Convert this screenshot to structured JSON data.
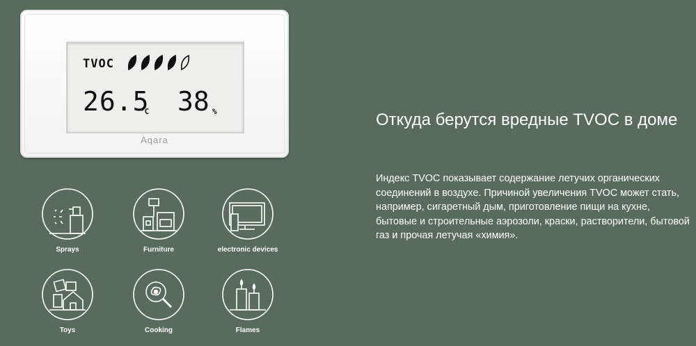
{
  "device": {
    "tvoc_label": "TVOC",
    "temperature": "26.5",
    "temperature_unit": "°C",
    "humidity": "38",
    "humidity_unit": "%",
    "brand": "Aqara",
    "leaf_level": {
      "filled": 4,
      "total": 5
    }
  },
  "sources": [
    {
      "label": "Sprays",
      "icon": "spray-icon"
    },
    {
      "label": "Furniture",
      "icon": "furniture-icon"
    },
    {
      "label": "electronic devices",
      "icon": "monitor-icon"
    },
    {
      "label": "Toys",
      "icon": "toys-icon"
    },
    {
      "label": "Cooking",
      "icon": "frying-pan-icon"
    },
    {
      "label": "Flames",
      "icon": "candle-icon"
    }
  ],
  "headline": "Откуда берутся вредные TVOC в доме",
  "body": "Индекс TVOC показывает содержание летучих органических соединений в воздухе. Причиной увеличения TVOC может стать, например, сигаретный дым, приготовление пищи на кухне, бытовые и строительные аэрозоли, краски, растворители, бытовой газ и прочая летучая «химия».",
  "colors": {
    "background": "#5a6b5e",
    "text": "#ffffff",
    "device": "#ffffff",
    "screen": "#eeeeec"
  }
}
